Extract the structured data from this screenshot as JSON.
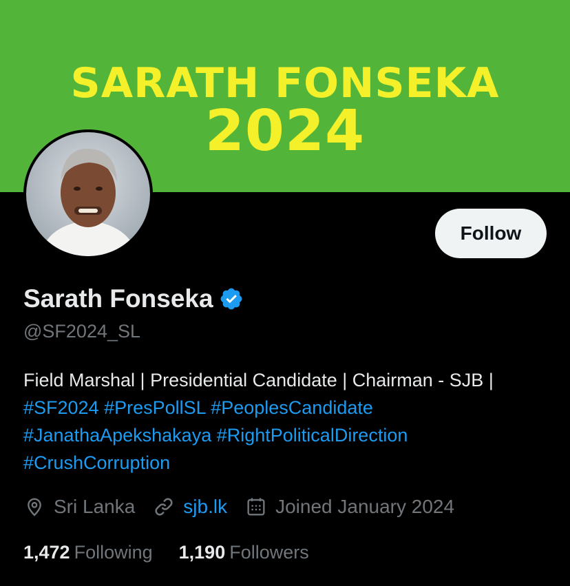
{
  "banner": {
    "line1": "SARATH FONSEKA",
    "line2": "2024"
  },
  "profile": {
    "display_name": "Sarath Fonseka",
    "handle": "@SF2024_SL",
    "verified": true,
    "follow_label": "Follow"
  },
  "bio": {
    "text": "Field Marshal | Presidential Candidate | Chairman - SJB | ",
    "hashtags": [
      "#SF2024",
      "#PresPollSL",
      "#PeoplesCandidate",
      "#JanathaApekshakaya",
      "#RightPoliticalDirection",
      "#CrushCorruption"
    ]
  },
  "meta": {
    "location": "Sri Lanka",
    "website": "sjb.lk",
    "joined": "Joined January 2024"
  },
  "stats": {
    "following_count": "1,472",
    "following_label": "Following",
    "followers_count": "1,190",
    "followers_label": "Followers"
  },
  "colors": {
    "banner_bg": "#53b43a",
    "banner_text": "#f4f12a",
    "accent": "#1d9bf0",
    "muted": "#71767b",
    "bg": "#000000"
  },
  "icons": [
    "verified-badge-icon",
    "location-pin-icon",
    "link-icon",
    "calendar-icon"
  ]
}
